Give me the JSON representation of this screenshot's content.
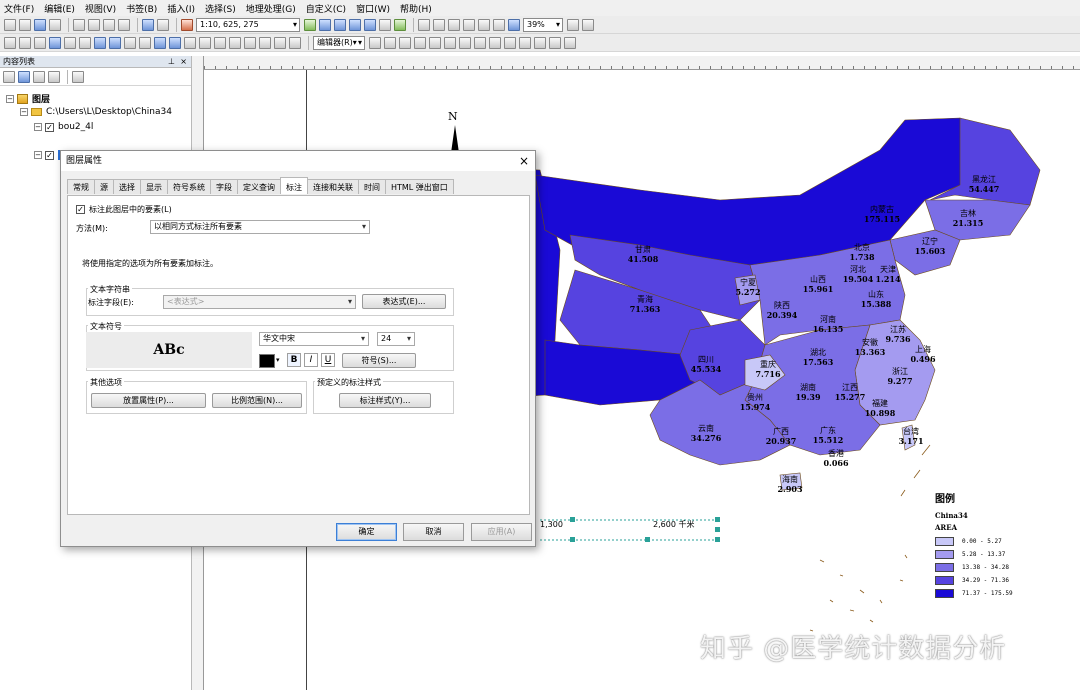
{
  "menu": [
    "文件(F)",
    "编辑(E)",
    "视图(V)",
    "书签(B)",
    "插入(I)",
    "选择(S)",
    "地理处理(G)",
    "自定义(C)",
    "窗口(W)",
    "帮助(H)"
  ],
  "toolbar": {
    "scale": "1:10, 625, 275",
    "zoom": "39%",
    "editor": "编辑器(R)▾"
  },
  "toc": {
    "title": "内容列表",
    "layers_root": "图层",
    "folder": "C:\\Users\\L\\Desktop\\China34",
    "layer1": "bou2_4l"
  },
  "dialog": {
    "title": "图层属性",
    "close": "×",
    "tabs": [
      "常规",
      "源",
      "选择",
      "显示",
      "符号系统",
      "字段",
      "定义查询",
      "标注",
      "连接和关联",
      "时间",
      "HTML 弹出窗口"
    ],
    "active_tab": "标注",
    "label_check": "标注此图层中的要素(L)",
    "method_label": "方法(M):",
    "method_value": "以相同方式标注所有要素",
    "info": "将使用指定的选项为所有要素加标注。",
    "text_string_group": "文本字符串",
    "label_field": "标注字段(E):",
    "label_field_value": "<表达式>",
    "expression_btn": "表达式(E)...",
    "text_symbol_group": "文本符号",
    "sample": "ABc",
    "font": "华文中宋",
    "font_size": "24",
    "bold": "B",
    "italic": "I",
    "underline": "U",
    "symbol_btn": "符号(S)...",
    "other_group": "其他选项",
    "placement_btn": "放置属性(P)...",
    "scale_btn": "比例范围(N)...",
    "predef_group": "预定义的标注样式",
    "style_btn": "标注样式(Y)...",
    "ok": "确定",
    "cancel": "取消",
    "apply": "应用(A)"
  },
  "map": {
    "north": "N",
    "scale_mid": "1,300",
    "scale_end": "2,600 千米",
    "watermark": "知乎 @医学统计数据分析",
    "labels": [
      {
        "name": "黑龙江",
        "value": "54.447"
      },
      {
        "name": "内蒙古",
        "value": "175.115"
      },
      {
        "name": "吉林",
        "value": "21.315"
      },
      {
        "name": "辽宁",
        "value": "15.603"
      },
      {
        "name": "北京",
        "value": "1.738"
      },
      {
        "name": "天津",
        "value": "1.214"
      },
      {
        "name": "河北",
        "value": "19.504"
      },
      {
        "name": "山西",
        "value": "15.961"
      },
      {
        "name": "山东",
        "value": "15.388"
      },
      {
        "name": "甘肃",
        "value": "41.508"
      },
      {
        "name": "宁夏",
        "value": "5.272"
      },
      {
        "name": "青海",
        "value": "71.363"
      },
      {
        "name": "陕西",
        "value": "20.394"
      },
      {
        "name": "河南",
        "value": "16.135"
      },
      {
        "name": "江苏",
        "value": "9.736"
      },
      {
        "name": "上海",
        "value": "0.496"
      },
      {
        "name": "安徽",
        "value": "13.363"
      },
      {
        "name": "湖北",
        "value": "17.563"
      },
      {
        "name": "四川",
        "value": "45.534"
      },
      {
        "name": "重庆",
        "value": "7.716"
      },
      {
        "name": "浙江",
        "value": "9.277"
      },
      {
        "name": "湖南",
        "value": "19.39"
      },
      {
        "name": "江西",
        "value": "15.277"
      },
      {
        "name": "福建",
        "value": "10.898"
      },
      {
        "name": "贵州",
        "value": "15.974"
      },
      {
        "name": "云南",
        "value": "34.276"
      },
      {
        "name": "广西",
        "value": "20.937"
      },
      {
        "name": "广东",
        "value": "15.512"
      },
      {
        "name": "台湾",
        "value": "3.171"
      },
      {
        "name": "香港",
        "value": "0.066"
      },
      {
        "name": "海南",
        "value": "2.903"
      }
    ]
  },
  "legend": {
    "title": "图例",
    "layer": "China34",
    "field": "AREA",
    "classes": [
      {
        "label": "0.00 - 5.27",
        "color": "#c8c8f8"
      },
      {
        "label": "5.28 - 13.37",
        "color": "#a49bf0"
      },
      {
        "label": "13.38 - 34.28",
        "color": "#7b6ee6"
      },
      {
        "label": "34.29 - 71.36",
        "color": "#5643e0"
      },
      {
        "label": "71.37 - 175.59",
        "color": "#1a0ad6"
      }
    ]
  }
}
